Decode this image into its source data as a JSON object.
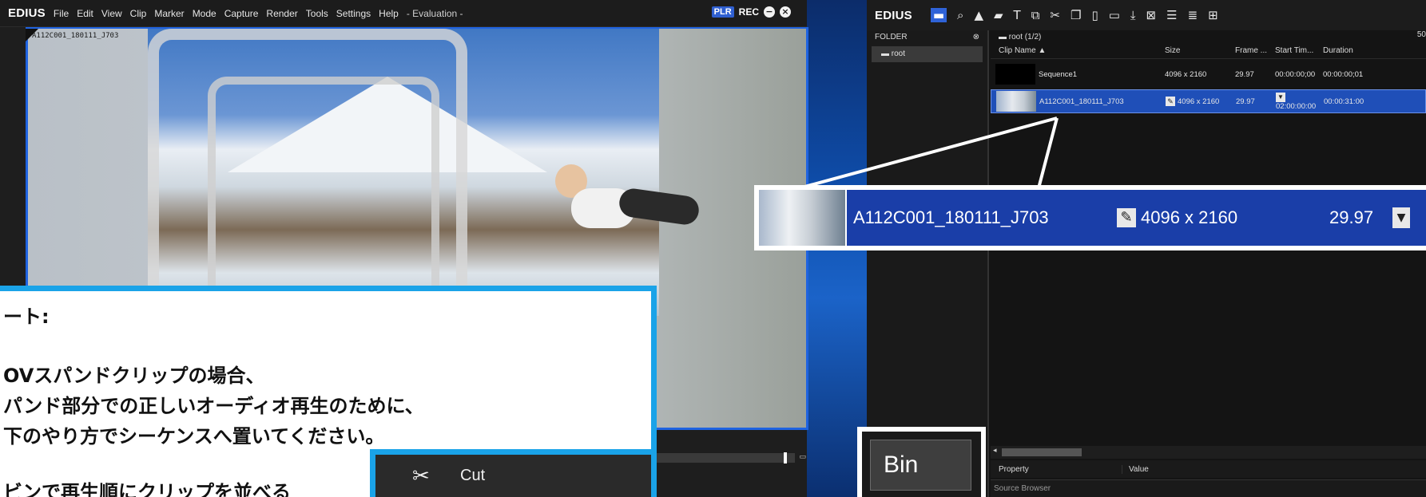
{
  "player": {
    "brand": "EDIUS",
    "menu": [
      "File",
      "Edit",
      "View",
      "Clip",
      "Marker",
      "Mode",
      "Capture",
      "Render",
      "Tools",
      "Settings",
      "Help"
    ],
    "evaluation": "- Evaluation -",
    "plr_badge": "PLR",
    "rec_label": "REC",
    "clip_overlay_name": "A112C001_180111_J703"
  },
  "bin": {
    "brand": "EDIUS",
    "folder_header": "FOLDER",
    "folder_root": "root",
    "clip_path": "root (1/2)",
    "zoom_pct": "50",
    "columns": {
      "name": "Clip Name ▲",
      "size": "Size",
      "frame": "Frame ...",
      "start": "Start Tim...",
      "duration": "Duration"
    },
    "rows": [
      {
        "name": "Sequence1",
        "size": "4096 x 2160",
        "frame": "29.97",
        "start": "00:00:00;00",
        "duration": "00:00:00;01"
      },
      {
        "name": "A112C001_180111_J703",
        "size": "4096 x 2160",
        "frame": "29.97",
        "start": "02:00:00:00",
        "duration": "00:00:31:00"
      }
    ],
    "property_label": "Property",
    "value_label": "Value",
    "source_browser": "Source Browser"
  },
  "zoom": {
    "name": "A112C001_180111_J703",
    "size": "4096 x 2160",
    "rate": "29.97"
  },
  "note": {
    "line1": "ート:",
    "line2": "OVスパンドクリップの場合、",
    "line3": "パンド部分での正しいオーディオ再生のために、",
    "line4": "下のやり方でシーケンスへ置いてください。",
    "line5": "ビンで再生順にクリップを並べる"
  },
  "context_menu": {
    "cut_label": "Cut"
  },
  "bin_tab": {
    "label": "Bin"
  },
  "colors": {
    "accent_blue": "#1aa3e8",
    "selection_blue": "#1f4fb8",
    "plr_blue": "#2f5fd0"
  }
}
